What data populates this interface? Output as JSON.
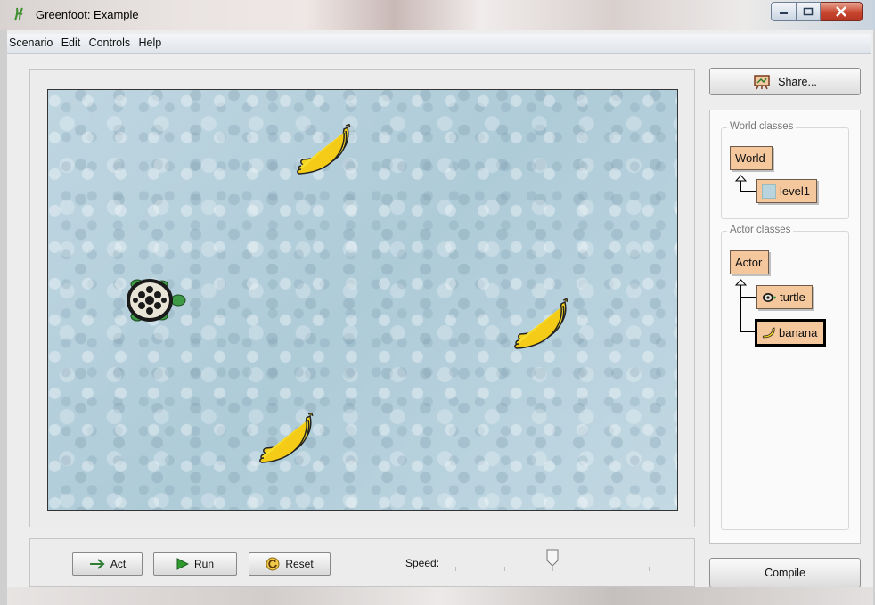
{
  "window": {
    "title": "Greenfoot: Example"
  },
  "menu": {
    "items": [
      "Scenario",
      "Edit",
      "Controls",
      "Help"
    ]
  },
  "world": {
    "actors": [
      {
        "type": "banana"
      },
      {
        "type": "turtle"
      },
      {
        "type": "banana"
      },
      {
        "type": "banana"
      }
    ]
  },
  "sidebar": {
    "share_label": "Share...",
    "world_classes": {
      "label": "World classes",
      "root": "World",
      "children": [
        "level1"
      ]
    },
    "actor_classes": {
      "label": "Actor classes",
      "root": "Actor",
      "children": [
        "turtle",
        "banana"
      ],
      "selected": "banana"
    },
    "compile_label": "Compile"
  },
  "controls": {
    "act_label": "Act",
    "run_label": "Run",
    "reset_label": "Reset",
    "speed_label": "Speed:",
    "speed_value": 0.5
  },
  "colors": {
    "class_fill": "#f4c79d",
    "world_water": "#b9d3df",
    "run_green": "#2e9a2e"
  }
}
